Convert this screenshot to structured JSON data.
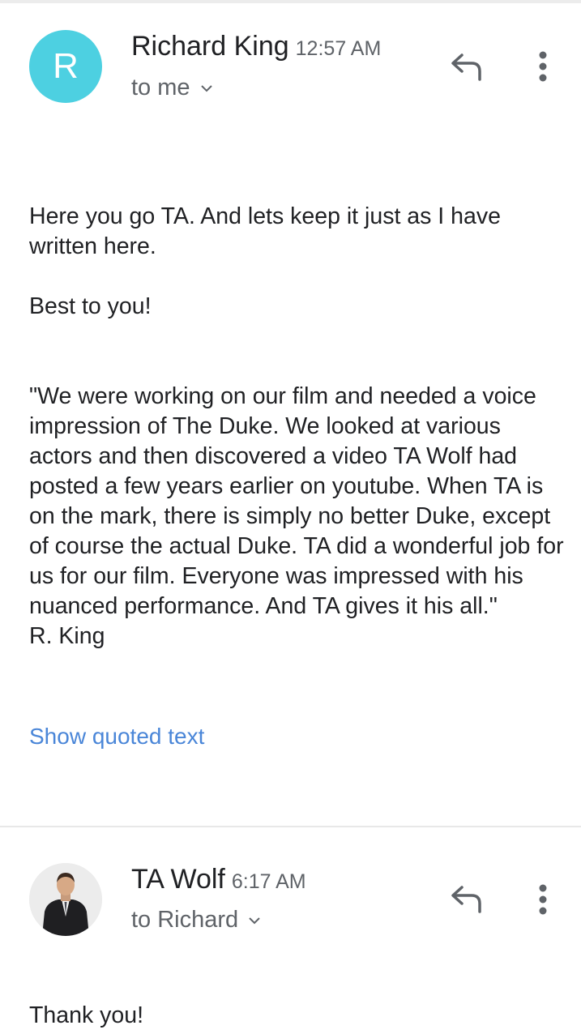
{
  "messages": [
    {
      "sender": "Richard King",
      "time": "12:57 AM",
      "avatar_letter": "R",
      "recipient": "to me",
      "body_intro": "Here you go TA.  And lets keep it just as I have written here.",
      "body_signoff": "Best to you!",
      "body_quote": "\"We were working on our film and needed a voice impression of The Duke.  We looked at various actors and then discovered a video TA Wolf had posted a few years earlier on youtube.  When TA is on the mark, there is simply no better Duke, except of course the actual Duke. TA did a wonderful job for us for our film.  Everyone was impressed with his nuanced performance. And TA gives it his all.\"\nR. King",
      "show_quoted": "Show quoted text"
    },
    {
      "sender": "TA Wolf",
      "time": "6:17 AM",
      "recipient": "to Richard",
      "body": "Thank you!"
    }
  ],
  "colors": {
    "avatar_bg": "#4dd0e1",
    "link": "#4a86d8",
    "secondary_text": "#5f6368"
  },
  "icons": {
    "reply": "reply-icon",
    "more": "more-vert-icon",
    "expand": "chevron-down-icon"
  }
}
